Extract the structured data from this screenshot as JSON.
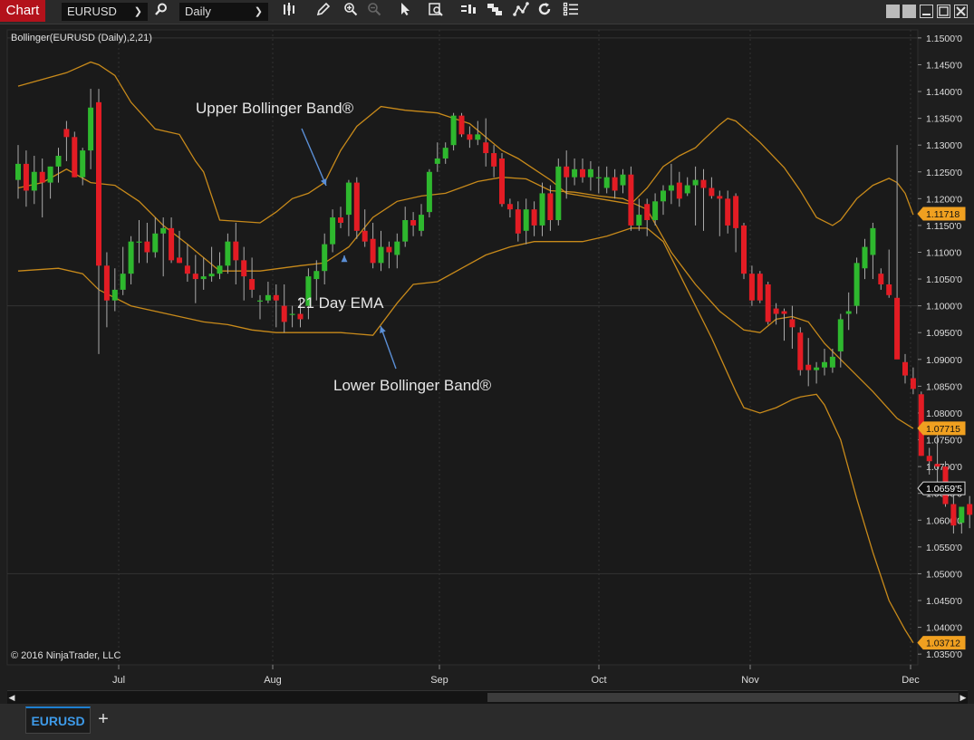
{
  "toolbar": {
    "app_label": "Chart",
    "instrument": "EURUSD",
    "period": "Daily"
  },
  "chart_title": "Bollinger(EURUSD (Daily),2,21)",
  "copyright": "© 2016 NinjaTrader, LLC",
  "tabs": [
    {
      "label": "EURUSD"
    }
  ],
  "annotations": {
    "upper": "Upper Bollinger Band®",
    "ema": "21 Day EMA",
    "lower": "Lower Bollinger Band®"
  },
  "colors": {
    "background": "#1e1e1e",
    "plot": "#1a1a1a",
    "band": "#c88a1a",
    "up_candle": "#2eb82e",
    "down_candle": "#e31c24",
    "arrow": "#5b8fd6",
    "marker": "#f0a020"
  },
  "chart_data": {
    "type": "candlestick",
    "title": "Bollinger(EURUSD (Daily),2,21)",
    "x_ticks": [
      "Jul",
      "Aug",
      "Sep",
      "Oct",
      "Nov",
      "Dec"
    ],
    "y_ticks": [
      "1.1500'0",
      "1.1450'0",
      "1.1400'0",
      "1.1350'0",
      "1.1300'0",
      "1.1250'0",
      "1.1200'0",
      "1.1150'0",
      "1.1100'0",
      "1.1050'0",
      "1.1000'0",
      "1.0950'0",
      "1.0900'0",
      "1.0850'0",
      "1.0800'0",
      "1.0750'0",
      "1.0700'0",
      "1.0650'0",
      "1.0600'0",
      "1.0550'0",
      "1.0500'0",
      "1.0450'0",
      "1.0400'0",
      "1.0350'0"
    ],
    "ylim": [
      1.033,
      1.1515
    ],
    "price_markers": [
      {
        "label": "1.11718",
        "value": 1.11718,
        "style": "band"
      },
      {
        "label": "1.07715",
        "value": 1.07715,
        "style": "band"
      },
      {
        "label": "1.0659'5",
        "value": 1.06595,
        "style": "last"
      },
      {
        "label": "1.03712",
        "value": 1.03712,
        "style": "band"
      }
    ],
    "upper_band": [
      [
        0,
        1.141
      ],
      [
        6,
        1.1435
      ],
      [
        9,
        1.1455
      ],
      [
        10,
        1.145
      ],
      [
        12,
        1.143
      ],
      [
        14,
        1.138
      ],
      [
        17,
        1.133
      ],
      [
        20,
        1.132
      ],
      [
        22,
        1.127
      ],
      [
        23,
        1.125
      ],
      [
        25,
        1.116
      ],
      [
        30,
        1.1155
      ],
      [
        32,
        1.1175
      ],
      [
        34,
        1.12
      ],
      [
        36,
        1.121
      ],
      [
        38,
        1.123
      ],
      [
        40,
        1.129
      ],
      [
        42,
        1.1335
      ],
      [
        45,
        1.1372
      ],
      [
        48,
        1.1365
      ],
      [
        52,
        1.136
      ],
      [
        56,
        1.134
      ],
      [
        60,
        1.129
      ],
      [
        62,
        1.1275
      ],
      [
        64,
        1.1255
      ],
      [
        66,
        1.1235
      ],
      [
        68,
        1.121
      ],
      [
        72,
        1.12
      ],
      [
        76,
        1.119
      ],
      [
        78,
        1.122
      ],
      [
        80,
        1.126
      ],
      [
        82,
        1.128
      ],
      [
        84,
        1.1295
      ],
      [
        85,
        1.131
      ],
      [
        87,
        1.1338
      ],
      [
        88,
        1.135
      ],
      [
        89,
        1.1345
      ],
      [
        92,
        1.1305
      ],
      [
        95,
        1.1258
      ],
      [
        97,
        1.1215
      ],
      [
        99,
        1.1165
      ],
      [
        101,
        1.115
      ],
      [
        102,
        1.116
      ],
      [
        104,
        1.12
      ],
      [
        106,
        1.1225
      ],
      [
        108,
        1.1238
      ],
      [
        109,
        1.123
      ],
      [
        110,
        1.121
      ],
      [
        111,
        1.117
      ]
    ],
    "ema": [
      [
        0,
        1.122
      ],
      [
        3,
        1.123
      ],
      [
        6,
        1.1255
      ],
      [
        9,
        1.123
      ],
      [
        12,
        1.1225
      ],
      [
        15,
        1.1195
      ],
      [
        18,
        1.115
      ],
      [
        21,
        1.1115
      ],
      [
        25,
        1.1065
      ],
      [
        30,
        1.1065
      ],
      [
        35,
        1.1075
      ],
      [
        38,
        1.108
      ],
      [
        41,
        1.111
      ],
      [
        44,
        1.1165
      ],
      [
        47,
        1.1195
      ],
      [
        50,
        1.1205
      ],
      [
        53,
        1.121
      ],
      [
        57,
        1.1232
      ],
      [
        60,
        1.124
      ],
      [
        63,
        1.1237
      ],
      [
        66,
        1.1215
      ],
      [
        69,
        1.1212
      ],
      [
        72,
        1.1205
      ],
      [
        75,
        1.12
      ],
      [
        78,
        1.118
      ],
      [
        81,
        1.11
      ],
      [
        84,
        1.104
      ],
      [
        87,
        1.099
      ],
      [
        90,
        1.0955
      ],
      [
        92,
        1.095
      ],
      [
        94,
        1.0975
      ],
      [
        96,
        1.098
      ],
      [
        98,
        1.097
      ],
      [
        100,
        1.093
      ],
      [
        103,
        1.0885
      ],
      [
        106,
        1.084
      ],
      [
        109,
        1.079
      ],
      [
        111,
        1.0771
      ]
    ],
    "lower_band": [
      [
        0,
        1.1065
      ],
      [
        5,
        1.107
      ],
      [
        8,
        1.106
      ],
      [
        10,
        1.103
      ],
      [
        14,
        1.1
      ],
      [
        20,
        1.098
      ],
      [
        23,
        1.097
      ],
      [
        26,
        1.0965
      ],
      [
        29,
        1.0955
      ],
      [
        32,
        1.095
      ],
      [
        36,
        1.095
      ],
      [
        40,
        1.095
      ],
      [
        44,
        1.0945
      ],
      [
        45,
        1.0965
      ],
      [
        47,
        1.1005
      ],
      [
        49,
        1.104
      ],
      [
        52,
        1.1045
      ],
      [
        55,
        1.107
      ],
      [
        58,
        1.1095
      ],
      [
        61,
        1.111
      ],
      [
        64,
        1.112
      ],
      [
        67,
        1.112
      ],
      [
        70,
        1.112
      ],
      [
        73,
        1.113
      ],
      [
        76,
        1.1145
      ],
      [
        78,
        1.1145
      ],
      [
        80,
        1.112
      ],
      [
        83,
        1.103
      ],
      [
        86,
        1.094
      ],
      [
        89,
        1.084
      ],
      [
        90,
        1.081
      ],
      [
        92,
        1.08
      ],
      [
        94,
        1.081
      ],
      [
        96,
        1.0825
      ],
      [
        97,
        1.083
      ],
      [
        99,
        1.0835
      ],
      [
        100,
        1.0815
      ],
      [
        102,
        1.075
      ],
      [
        104,
        1.064
      ],
      [
        106,
        1.054
      ],
      [
        108,
        1.045
      ],
      [
        110,
        1.0395
      ],
      [
        111,
        1.0371
      ]
    ],
    "candles": [
      {
        "o": 1.1235,
        "h": 1.13,
        "l": 1.12,
        "c": 1.1265
      },
      {
        "o": 1.1265,
        "h": 1.129,
        "l": 1.1185,
        "c": 1.1215
      },
      {
        "o": 1.1215,
        "h": 1.128,
        "l": 1.119,
        "c": 1.125
      },
      {
        "o": 1.125,
        "h": 1.1275,
        "l": 1.1165,
        "c": 1.123
      },
      {
        "o": 1.123,
        "h": 1.126,
        "l": 1.12,
        "c": 1.126
      },
      {
        "o": 1.126,
        "h": 1.1295,
        "l": 1.123,
        "c": 1.128
      },
      {
        "o": 1.133,
        "h": 1.1345,
        "l": 1.127,
        "c": 1.1315
      },
      {
        "o": 1.1315,
        "h": 1.1325,
        "l": 1.124,
        "c": 1.124
      },
      {
        "o": 1.124,
        "h": 1.1295,
        "l": 1.1225,
        "c": 1.129
      },
      {
        "o": 1.129,
        "h": 1.1405,
        "l": 1.1255,
        "c": 1.137
      },
      {
        "o": 1.138,
        "h": 1.1405,
        "l": 1.091,
        "c": 1.1075
      },
      {
        "o": 1.1075,
        "h": 1.11,
        "l": 1.096,
        "c": 1.101
      },
      {
        "o": 1.101,
        "h": 1.107,
        "l": 1.099,
        "c": 1.103
      },
      {
        "o": 1.103,
        "h": 1.111,
        "l": 1.102,
        "c": 1.106
      },
      {
        "o": 1.106,
        "h": 1.113,
        "l": 1.104,
        "c": 1.112
      },
      {
        "o": 1.112,
        "h": 1.116,
        "l": 1.108,
        "c": 1.112
      },
      {
        "o": 1.112,
        "h": 1.1155,
        "l": 1.108,
        "c": 1.11
      },
      {
        "o": 1.11,
        "h": 1.1165,
        "l": 1.109,
        "c": 1.1135
      },
      {
        "o": 1.1135,
        "h": 1.1165,
        "l": 1.1055,
        "c": 1.1145
      },
      {
        "o": 1.1145,
        "h": 1.1165,
        "l": 1.108,
        "c": 1.1085
      },
      {
        "o": 1.109,
        "h": 1.114,
        "l": 1.108,
        "c": 1.108
      },
      {
        "o": 1.1075,
        "h": 1.1115,
        "l": 1.1045,
        "c": 1.106
      },
      {
        "o": 1.106,
        "h": 1.1095,
        "l": 1.1005,
        "c": 1.105
      },
      {
        "o": 1.105,
        "h": 1.109,
        "l": 1.103,
        "c": 1.1055
      },
      {
        "o": 1.1055,
        "h": 1.111,
        "l": 1.1045,
        "c": 1.106
      },
      {
        "o": 1.106,
        "h": 1.11,
        "l": 1.105,
        "c": 1.1075
      },
      {
        "o": 1.1075,
        "h": 1.1135,
        "l": 1.106,
        "c": 1.112
      },
      {
        "o": 1.112,
        "h": 1.1155,
        "l": 1.104,
        "c": 1.1085
      },
      {
        "o": 1.1085,
        "h": 1.111,
        "l": 1.101,
        "c": 1.1055
      },
      {
        "o": 1.105,
        "h": 1.109,
        "l": 1.1015,
        "c": 1.103
      },
      {
        "o": 1.101,
        "h": 1.102,
        "l": 1.0975,
        "c": 1.101
      },
      {
        "o": 1.101,
        "h": 1.1045,
        "l": 1.1005,
        "c": 1.102
      },
      {
        "o": 1.102,
        "h": 1.104,
        "l": 1.096,
        "c": 1.101
      },
      {
        "o": 1.1,
        "h": 1.104,
        "l": 1.095,
        "c": 1.097
      },
      {
        "o": 1.0985,
        "h": 1.1,
        "l": 1.096,
        "c": 1.0985
      },
      {
        "o": 1.0985,
        "h": 1.1015,
        "l": 1.096,
        "c": 1.0975
      },
      {
        "o": 1.1,
        "h": 1.107,
        "l": 1.0975,
        "c": 1.1055
      },
      {
        "o": 1.105,
        "h": 1.1085,
        "l": 1.101,
        "c": 1.1065
      },
      {
        "o": 1.1065,
        "h": 1.1135,
        "l": 1.104,
        "c": 1.1115
      },
      {
        "o": 1.1115,
        "h": 1.118,
        "l": 1.11,
        "c": 1.1165
      },
      {
        "o": 1.1165,
        "h": 1.1185,
        "l": 1.1145,
        "c": 1.1155
      },
      {
        "o": 1.117,
        "h": 1.1235,
        "l": 1.113,
        "c": 1.123
      },
      {
        "o": 1.123,
        "h": 1.124,
        "l": 1.1125,
        "c": 1.114
      },
      {
        "o": 1.114,
        "h": 1.118,
        "l": 1.111,
        "c": 1.112
      },
      {
        "o": 1.1125,
        "h": 1.1155,
        "l": 1.107,
        "c": 1.108
      },
      {
        "o": 1.108,
        "h": 1.114,
        "l": 1.1065,
        "c": 1.111
      },
      {
        "o": 1.111,
        "h": 1.112,
        "l": 1.107,
        "c": 1.11
      },
      {
        "o": 1.1095,
        "h": 1.1135,
        "l": 1.107,
        "c": 1.112
      },
      {
        "o": 1.112,
        "h": 1.1185,
        "l": 1.111,
        "c": 1.116
      },
      {
        "o": 1.116,
        "h": 1.1175,
        "l": 1.113,
        "c": 1.115
      },
      {
        "o": 1.114,
        "h": 1.119,
        "l": 1.113,
        "c": 1.117
      },
      {
        "o": 1.1175,
        "h": 1.1255,
        "l": 1.1165,
        "c": 1.125
      },
      {
        "o": 1.1265,
        "h": 1.1305,
        "l": 1.125,
        "c": 1.1275
      },
      {
        "o": 1.1275,
        "h": 1.1305,
        "l": 1.1265,
        "c": 1.1295
      },
      {
        "o": 1.13,
        "h": 1.136,
        "l": 1.129,
        "c": 1.1355
      },
      {
        "o": 1.1355,
        "h": 1.136,
        "l": 1.1315,
        "c": 1.132
      },
      {
        "o": 1.132,
        "h": 1.1335,
        "l": 1.1295,
        "c": 1.131
      },
      {
        "o": 1.131,
        "h": 1.1345,
        "l": 1.13,
        "c": 1.132
      },
      {
        "o": 1.1305,
        "h": 1.135,
        "l": 1.126,
        "c": 1.1285
      },
      {
        "o": 1.1285,
        "h": 1.13,
        "l": 1.124,
        "c": 1.126
      },
      {
        "o": 1.1275,
        "h": 1.1285,
        "l": 1.1185,
        "c": 1.119
      },
      {
        "o": 1.119,
        "h": 1.12,
        "l": 1.1165,
        "c": 1.118
      },
      {
        "o": 1.118,
        "h": 1.1195,
        "l": 1.112,
        "c": 1.1135
      },
      {
        "o": 1.114,
        "h": 1.12,
        "l": 1.1115,
        "c": 1.118
      },
      {
        "o": 1.118,
        "h": 1.1195,
        "l": 1.113,
        "c": 1.115
      },
      {
        "o": 1.115,
        "h": 1.123,
        "l": 1.113,
        "c": 1.121
      },
      {
        "o": 1.121,
        "h": 1.1225,
        "l": 1.114,
        "c": 1.116
      },
      {
        "o": 1.116,
        "h": 1.1275,
        "l": 1.115,
        "c": 1.126
      },
      {
        "o": 1.126,
        "h": 1.129,
        "l": 1.12,
        "c": 1.124
      },
      {
        "o": 1.124,
        "h": 1.1275,
        "l": 1.1225,
        "c": 1.1255
      },
      {
        "o": 1.1255,
        "h": 1.1275,
        "l": 1.123,
        "c": 1.124
      },
      {
        "o": 1.124,
        "h": 1.127,
        "l": 1.1215,
        "c": 1.1255
      },
      {
        "o": 1.124,
        "h": 1.126,
        "l": 1.121,
        "c": 1.124
      },
      {
        "o": 1.122,
        "h": 1.126,
        "l": 1.121,
        "c": 1.124
      },
      {
        "o": 1.124,
        "h": 1.1255,
        "l": 1.12,
        "c": 1.1215
      },
      {
        "o": 1.1225,
        "h": 1.1255,
        "l": 1.121,
        "c": 1.1245
      },
      {
        "o": 1.1245,
        "h": 1.126,
        "l": 1.114,
        "c": 1.115
      },
      {
        "o": 1.115,
        "h": 1.12,
        "l": 1.114,
        "c": 1.117
      },
      {
        "o": 1.119,
        "h": 1.12,
        "l": 1.113,
        "c": 1.116
      },
      {
        "o": 1.116,
        "h": 1.121,
        "l": 1.115,
        "c": 1.1195
      },
      {
        "o": 1.1195,
        "h": 1.1225,
        "l": 1.117,
        "c": 1.1215
      },
      {
        "o": 1.1215,
        "h": 1.1265,
        "l": 1.119,
        "c": 1.1225
      },
      {
        "o": 1.123,
        "h": 1.125,
        "l": 1.1185,
        "c": 1.12
      },
      {
        "o": 1.121,
        "h": 1.124,
        "l": 1.1205,
        "c": 1.1225
      },
      {
        "o": 1.1225,
        "h": 1.126,
        "l": 1.115,
        "c": 1.1235
      },
      {
        "o": 1.1235,
        "h": 1.1255,
        "l": 1.114,
        "c": 1.122
      },
      {
        "o": 1.122,
        "h": 1.124,
        "l": 1.12,
        "c": 1.1205
      },
      {
        "o": 1.1205,
        "h": 1.1215,
        "l": 1.113,
        "c": 1.12
      },
      {
        "o": 1.12,
        "h": 1.1215,
        "l": 1.1135,
        "c": 1.115
      },
      {
        "o": 1.1205,
        "h": 1.121,
        "l": 1.11,
        "c": 1.1145
      },
      {
        "o": 1.115,
        "h": 1.1155,
        "l": 1.105,
        "c": 1.106
      },
      {
        "o": 1.106,
        "h": 1.1075,
        "l": 1.1,
        "c": 1.101
      },
      {
        "o": 1.106,
        "h": 1.1065,
        "l": 1.1005,
        "c": 1.101
      },
      {
        "o": 1.104,
        "h": 1.1045,
        "l": 1.0965,
        "c": 1.097
      },
      {
        "o": 1.0995,
        "h": 1.1005,
        "l": 1.0965,
        "c": 1.0985
      },
      {
        "o": 1.099,
        "h": 1.0995,
        "l": 1.0935,
        "c": 1.0985
      },
      {
        "o": 1.0975,
        "h": 1.1,
        "l": 1.092,
        "c": 1.096
      },
      {
        "o": 1.095,
        "h": 1.096,
        "l": 1.087,
        "c": 1.088
      },
      {
        "o": 1.089,
        "h": 1.094,
        "l": 1.085,
        "c": 1.088
      },
      {
        "o": 1.088,
        "h": 1.0895,
        "l": 1.0855,
        "c": 1.0885
      },
      {
        "o": 1.0885,
        "h": 1.092,
        "l": 1.087,
        "c": 1.0895
      },
      {
        "o": 1.0885,
        "h": 1.092,
        "l": 1.0875,
        "c": 1.0905
      },
      {
        "o": 1.0915,
        "h": 1.0985,
        "l": 1.0885,
        "c": 1.0975
      },
      {
        "o": 1.0985,
        "h": 1.1025,
        "l": 1.0955,
        "c": 1.099
      },
      {
        "o": 1.1,
        "h": 1.109,
        "l": 1.0985,
        "c": 1.108
      },
      {
        "o": 1.107,
        "h": 1.1125,
        "l": 1.105,
        "c": 1.111
      },
      {
        "o": 1.1095,
        "h": 1.1155,
        "l": 1.105,
        "c": 1.1145
      },
      {
        "o": 1.106,
        "h": 1.107,
        "l": 1.103,
        "c": 1.104
      },
      {
        "o": 1.104,
        "h": 1.1105,
        "l": 1.1015,
        "c": 1.102
      },
      {
        "o": 1.1015,
        "h": 1.13,
        "l": 1.092,
        "c": 1.09
      },
      {
        "o": 1.0895,
        "h": 1.091,
        "l": 1.0855,
        "c": 1.087
      },
      {
        "o": 1.0865,
        "h": 1.0885,
        "l": 1.0835,
        "c": 1.0845
      },
      {
        "o": 1.0835,
        "h": 1.084,
        "l": 1.072,
        "c": 1.072
      },
      {
        "o": 1.072,
        "h": 1.0735,
        "l": 1.0685,
        "c": 1.071
      },
      {
        "o": 1.0705,
        "h": 1.076,
        "l": 1.067,
        "c": 1.07
      },
      {
        "o": 1.07,
        "h": 1.071,
        "l": 1.0625,
        "c": 1.063
      },
      {
        "o": 1.063,
        "h": 1.0645,
        "l": 1.0575,
        "c": 1.059
      },
      {
        "o": 1.0595,
        "h": 1.0625,
        "l": 1.0575,
        "c": 1.0625
      },
      {
        "o": 1.063,
        "h": 1.0645,
        "l": 1.0585,
        "c": 1.061
      },
      {
        "o": 1.063,
        "h": 1.0635,
        "l": 1.0535,
        "c": 1.0545
      },
      {
        "o": 1.0545,
        "h": 1.0565,
        "l": 1.052,
        "c": 1.0555
      },
      {
        "o": 1.056,
        "h": 1.062,
        "l": 1.0545,
        "c": 1.059
      },
      {
        "o": 1.059,
        "h": 1.063,
        "l": 1.056,
        "c": 1.061
      },
      {
        "o": 1.061,
        "h": 1.0665,
        "l": 1.0605,
        "c": 1.065
      },
      {
        "o": 1.065,
        "h": 1.067,
        "l": 1.055,
        "c": 1.059
      },
      {
        "o": 1.059,
        "h": 1.0665,
        "l": 1.058,
        "c": 1.066
      }
    ]
  }
}
